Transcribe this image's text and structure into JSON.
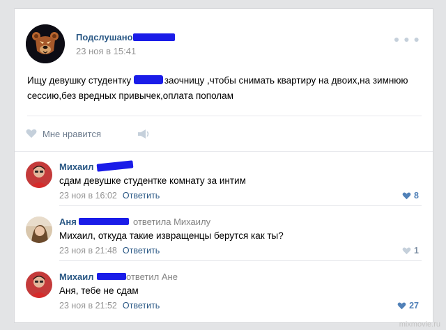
{
  "post": {
    "author": "Подслушано",
    "date": "23 ноя в 15:41",
    "text_before_redaction": "Ищу девушку студентку ",
    "text_after_redaction": "заочницу ,чтобы снимать квартиру на двоих,на зимнюю сессию,без вредных привычек,оплата пополам",
    "like_label": "Мне нравится",
    "icons": [
      "bear-avatar-icon",
      "more-icon",
      "heart-icon",
      "share-icon"
    ]
  },
  "comments": [
    {
      "author": "Михаил",
      "reply_to": "",
      "text": "сдам девушке студентке комнату за интим",
      "date": "23 ноя в 16:02",
      "action": "Ответить",
      "likes": "8"
    },
    {
      "author": "Аня",
      "reply_to": "ответила Михаилу",
      "text": "Михаил, откуда такие извращенцы берутся как ты?",
      "date": "23 ноя в 21:48",
      "action": "Ответить",
      "likes": "1"
    },
    {
      "author": "Михаил",
      "reply_to": "ответил Ане",
      "text": "Аня, тебе не сдам",
      "date": "23 ноя в 21:52",
      "action": "Ответить",
      "likes": "27"
    }
  ],
  "watermark": "mixmovie.ru",
  "colors": {
    "link": "#2a5885",
    "meta": "#939393",
    "like_accent": "#5181b8",
    "redaction": "#1a1ce8"
  }
}
